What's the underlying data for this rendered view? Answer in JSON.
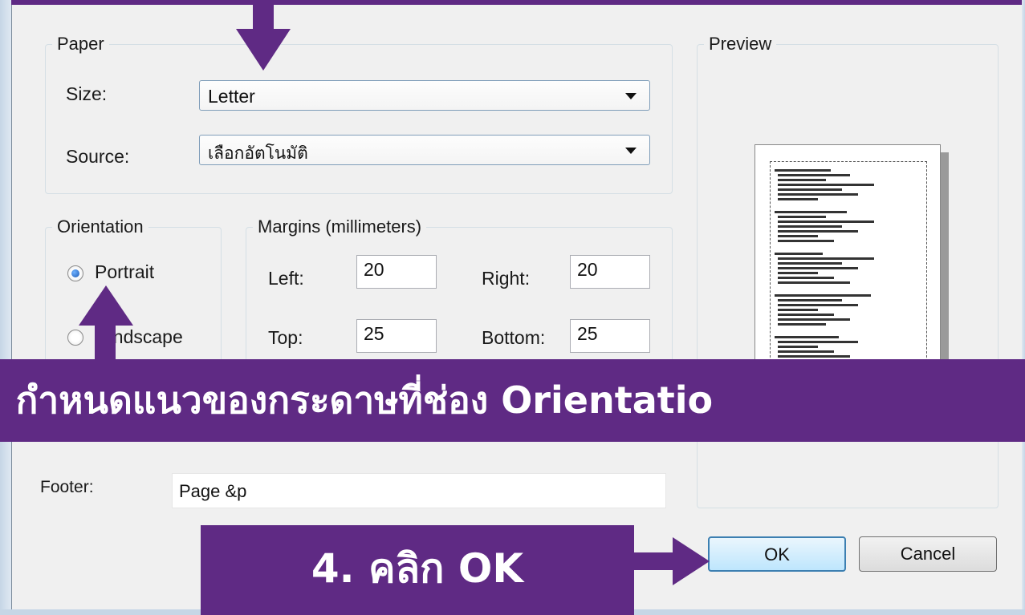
{
  "paper": {
    "legend": "Paper",
    "size_label": "Size:",
    "size_value": "Letter",
    "source_label": "Source:",
    "source_value": "เลือกอัตโนมัติ"
  },
  "orientation": {
    "legend": "Orientation",
    "portrait": "Portrait",
    "landscape": "andscape",
    "selected": "Portrait"
  },
  "margins": {
    "legend": "Margins (millimeters)",
    "left_label": "Left:",
    "left_value": "20",
    "right_label": "Right:",
    "right_value": "20",
    "top_label": "Top:",
    "top_value": "25",
    "bottom_label": "Bottom:",
    "bottom_value": "25"
  },
  "preview": {
    "legend": "Preview"
  },
  "footer": {
    "label": "Footer:",
    "value": "Page &p"
  },
  "buttons": {
    "ok": "OK",
    "cancel": "Cancel"
  },
  "annotations": {
    "orientation_step": ". กำหนดแนวของกระดาษที่ช่อง Orientatio",
    "ok_step": "4. คลิก OK",
    "color": "#5f2a84"
  }
}
